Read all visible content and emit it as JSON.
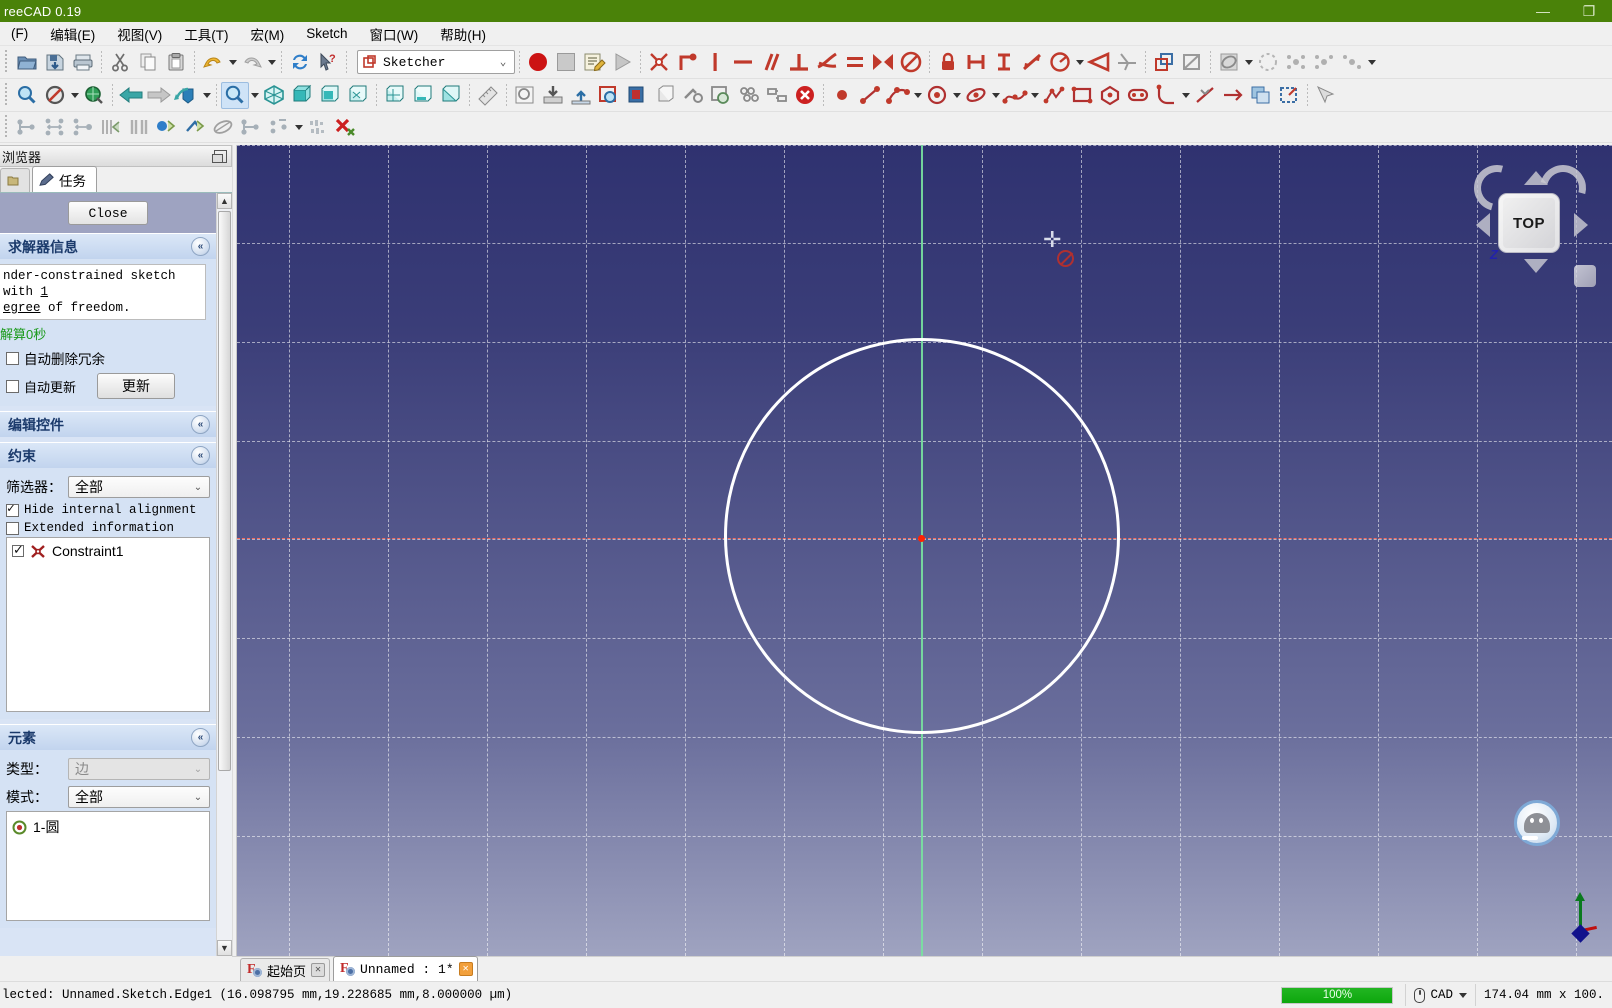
{
  "titlebar": {
    "title": "reeCAD 0.19",
    "minimize": "—",
    "restore": "❐"
  },
  "menubar": [
    {
      "label": "(F)"
    },
    {
      "label": "编辑(E)"
    },
    {
      "label": "视图(V)"
    },
    {
      "label": "工具(T)"
    },
    {
      "label": "宏(M)"
    },
    {
      "label": "Sketch"
    },
    {
      "label": "窗口(W)"
    },
    {
      "label": "帮助(H)"
    }
  ],
  "workbench": {
    "selected": "Sketcher",
    "arrow": "⌄"
  },
  "toolbars": {
    "file": [
      {
        "name": "open-icon",
        "label": "Open"
      },
      {
        "name": "save-icon",
        "label": "Save"
      },
      {
        "name": "print-icon",
        "label": "Print"
      },
      {
        "name": "cut-icon",
        "label": "Cut"
      },
      {
        "name": "copy-icon",
        "label": "Copy"
      },
      {
        "name": "paste-icon",
        "label": "Paste"
      },
      {
        "name": "undo-icon",
        "label": "Undo"
      },
      {
        "name": "redo-icon",
        "label": "Redo"
      },
      {
        "name": "refresh-icon",
        "label": "Refresh"
      },
      {
        "name": "whats-this-icon",
        "label": "What's This"
      }
    ],
    "macro": [
      {
        "name": "macro-record-icon",
        "label": "Macro recording"
      },
      {
        "name": "macro-stop-icon",
        "label": "Stop macro recording"
      },
      {
        "name": "macro-edit-icon",
        "label": "Macros"
      },
      {
        "name": "macro-execute-icon",
        "label": "Execute macro"
      }
    ],
    "constraints": [
      {
        "name": "constrain-coincident-icon",
        "label": "Coincident"
      },
      {
        "name": "constrain-point-on-object-icon",
        "label": "Point on object"
      },
      {
        "name": "constrain-vertical-icon",
        "label": "Vertical"
      },
      {
        "name": "constrain-horizontal-icon",
        "label": "Horizontal"
      },
      {
        "name": "constrain-parallel-icon",
        "label": "Parallel"
      },
      {
        "name": "constrain-perpendicular-icon",
        "label": "Perpendicular"
      },
      {
        "name": "constrain-tangent-icon",
        "label": "Tangent"
      },
      {
        "name": "constrain-equal-icon",
        "label": "Equal"
      },
      {
        "name": "constrain-symmetric-icon",
        "label": "Symmetric"
      },
      {
        "name": "constrain-block-icon",
        "label": "Block"
      },
      {
        "name": "constrain-lock-icon",
        "label": "Lock"
      },
      {
        "name": "constrain-distance-horizontal-icon",
        "label": "Horizontal distance"
      },
      {
        "name": "constrain-distance-vertical-icon",
        "label": "Vertical distance"
      },
      {
        "name": "constrain-distance-icon",
        "label": "Distance"
      },
      {
        "name": "constrain-radius-icon",
        "label": "Radius"
      },
      {
        "name": "constrain-angle-icon",
        "label": "Angle"
      },
      {
        "name": "constrain-snells-law-icon",
        "label": "Snell's law"
      },
      {
        "name": "toggle-driving-icon",
        "label": "Toggle driving/reference"
      },
      {
        "name": "toggle-active-icon",
        "label": "Activate/deactivate constraint"
      }
    ],
    "visual": [
      {
        "name": "sketch-visual-icon",
        "label": "Visual sketch"
      },
      {
        "name": "rendering-order-icon",
        "label": "Rendering order"
      },
      {
        "name": "cluster-1-icon",
        "label": "Cluster"
      },
      {
        "name": "cluster-2-icon",
        "label": "Cluster"
      },
      {
        "name": "cluster-3-icon",
        "label": "Cluster"
      }
    ],
    "view": [
      {
        "name": "fit-all-icon",
        "label": "Fit all"
      },
      {
        "name": "fit-selection-icon",
        "label": "Fit selection"
      },
      {
        "name": "draw-style-icon",
        "label": "Draw style"
      },
      {
        "name": "back-arrow-icon",
        "label": "Back"
      },
      {
        "name": "forward-arrow-icon",
        "label": "Forward"
      },
      {
        "name": "iso-view-icon",
        "label": "Isometric"
      },
      {
        "name": "zoom-icon",
        "label": "Zoom"
      },
      {
        "name": "axonometric-icon",
        "label": "Axonometric"
      },
      {
        "name": "front-view-icon",
        "label": "Front"
      },
      {
        "name": "top-view-icon",
        "label": "Top"
      },
      {
        "name": "right-view-icon",
        "label": "Right"
      },
      {
        "name": "rear-view-icon",
        "label": "Rear"
      },
      {
        "name": "bottom-view-icon",
        "label": "Bottom"
      },
      {
        "name": "left-view-icon",
        "label": "Left"
      },
      {
        "name": "measure-icon",
        "label": "Measure"
      }
    ],
    "sketch": [
      {
        "name": "create-sketch-icon",
        "label": "Create sketch"
      },
      {
        "name": "map-sketch-icon",
        "label": "Map sketch"
      },
      {
        "name": "reorient-sketch-icon",
        "label": "Reorient sketch"
      },
      {
        "name": "view-sketch-icon",
        "label": "View sketch"
      },
      {
        "name": "view-section-icon",
        "label": "View section"
      },
      {
        "name": "leave-sketch-icon",
        "label": "Leave sketch"
      },
      {
        "name": "validate-sketch-icon",
        "label": "Validate sketch"
      },
      {
        "name": "merge-sketch-icon",
        "label": "Merge sketches"
      },
      {
        "name": "mirror-sketch-icon",
        "label": "Mirror sketch"
      },
      {
        "name": "stop-operation-icon",
        "label": "Stop operation"
      }
    ],
    "geometry": [
      {
        "name": "create-point-icon",
        "label": "Point"
      },
      {
        "name": "create-line-icon",
        "label": "Line"
      },
      {
        "name": "create-arc-icon",
        "label": "Arc"
      },
      {
        "name": "create-circle-icon",
        "label": "Circle"
      },
      {
        "name": "create-conic-icon",
        "label": "Conic"
      },
      {
        "name": "create-bspline-icon",
        "label": "B-spline"
      },
      {
        "name": "create-polyline-icon",
        "label": "Polyline"
      },
      {
        "name": "create-rectangle-icon",
        "label": "Rectangle"
      },
      {
        "name": "create-polygon-icon",
        "label": "Polygon"
      },
      {
        "name": "create-slot-icon",
        "label": "Slot"
      },
      {
        "name": "create-fillet-icon",
        "label": "Fillet"
      },
      {
        "name": "trim-edge-icon",
        "label": "Trim edge"
      },
      {
        "name": "extend-edge-icon",
        "label": "Extend edge"
      },
      {
        "name": "external-geometry-icon",
        "label": "External geometry"
      },
      {
        "name": "carbon-copy-icon",
        "label": "Carbon copy"
      },
      {
        "name": "toggle-construction-icon",
        "label": "Toggle construction geometry"
      },
      {
        "name": "select-elements-icon",
        "label": "Select elements"
      }
    ],
    "tools": [
      {
        "name": "select-constraints-icon",
        "label": "Select constraints"
      },
      {
        "name": "select-horizontal-axis-icon",
        "label": "Select horizontal axis"
      },
      {
        "name": "select-vertical-axis-icon",
        "label": "Select vertical axis"
      },
      {
        "name": "select-redundant-icon",
        "label": "Select redundant constraints"
      },
      {
        "name": "select-conflicting-icon",
        "label": "Select conflicting constraints"
      },
      {
        "name": "select-malformed-icon",
        "label": "Select malformed constraints"
      },
      {
        "name": "select-partially-redundant-icon",
        "label": "Select partially redundant"
      },
      {
        "name": "select-elliptical-axes-icon",
        "label": "Select elliptical axes"
      },
      {
        "name": "restore-internal-geometry-icon",
        "label": "Restore internal geometry"
      },
      {
        "name": "symmetry-icon",
        "label": "Symmetry"
      },
      {
        "name": "clone-icon",
        "label": "Clone"
      },
      {
        "name": "delete-all-constraints-icon",
        "label": "Delete all constraints"
      }
    ]
  },
  "leftpanel": {
    "panel_title": "浏览器",
    "float_icon": "restore-panel-icon",
    "tabs": [
      {
        "label": "",
        "icon": "model-tab-icon",
        "selected": false
      },
      {
        "label": "任务",
        "icon": "pencil-icon",
        "selected": true
      }
    ],
    "close_button": "Close",
    "solver": {
      "header": "求解器信息",
      "chevron": "«",
      "message_line1_pre": "nder-constrained sketch with ",
      "message_line1_link": "1",
      "message_line2_link": "egree",
      "message_line2_post": " of freedom.",
      "solve_time": "解算0秒",
      "auto_remove_redundants": "自动删除冗余",
      "auto_update": "自动更新",
      "update_button": "更新"
    },
    "edit_controls": {
      "header": "编辑控件",
      "chevron": "«"
    },
    "constraints": {
      "header": "约束",
      "chevron": "«",
      "filter_label": "筛选器：",
      "filter_value": "全部",
      "hide_internal_alignment": "Hide internal alignment",
      "extended_information": "Extended information",
      "items": [
        {
          "label": "Constraint1",
          "icon": "constraint-symmetric-icon",
          "checked": true
        }
      ]
    },
    "elements": {
      "header": "元素",
      "chevron": "«",
      "type_label": "类型：",
      "type_value": "边",
      "mode_label": "模式：",
      "mode_value": "全部",
      "items": [
        {
          "label": "1-圆",
          "icon": "circle-element-icon"
        }
      ]
    }
  },
  "view3d": {
    "navcube": {
      "face_label": "TOP",
      "z_label": "Z",
      "arrows": [
        "up-arrow-icon",
        "down-arrow-icon",
        "left-arrow-icon",
        "right-arrow-icon"
      ],
      "rotate_icons": [
        "rotate-ccw-icon",
        "rotate-cw-icon"
      ]
    },
    "face_button": "navigation-face-icon",
    "axis_cross": "axis-origin-icon",
    "cursor": {
      "cross": "crosshair-cursor",
      "badge": "forbidden-icon"
    },
    "geometry": {
      "circle": "sketch-circle",
      "origin_point": "origin-point",
      "x_axis": "x-axis-line",
      "y_axis": "y-axis-line"
    },
    "colors": {
      "bg_top": "#2f3270",
      "bg_bottom": "#9fa3c0",
      "circle": "#ffffff",
      "x_axis": "#ff6e5a",
      "y_axis": "#78e1a0",
      "origin": "#ff2200",
      "grid": "#ffffff"
    }
  },
  "document_tabs": [
    {
      "label": "起始页",
      "selected": false,
      "close": "✕"
    },
    {
      "label": "Unnamed : 1*",
      "selected": true,
      "close": "✕"
    }
  ],
  "statusbar": {
    "message": "lected: Unnamed.Sketch.Edge1  (16.098795 mm,19.228685 mm,8.000000 µm)",
    "progress_label": "100%",
    "progress_percent": 100,
    "nav_style": "CAD",
    "nav_caret": "▾",
    "dimensions": "174.04 mm x 100."
  }
}
